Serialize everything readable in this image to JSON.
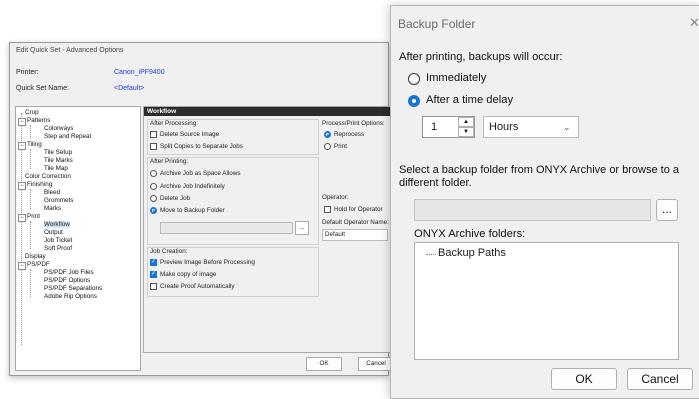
{
  "quickset": {
    "title": "Edit Quick Set - Advanced Options",
    "printer_label": "Printer:",
    "printer_value": "Canon_iPF9400",
    "quickset_label": "Quick Set Name:",
    "quickset_value": "<Default>",
    "tree": [
      "Crop",
      "Patterns",
      "Colorways",
      "Step and Repeat",
      "Tiling",
      "Tile Setup",
      "Tile Marks",
      "Tile Map",
      "Color Correction",
      "Finishing",
      "Bleed",
      "Grommets",
      "Marks",
      "Print",
      "Workflow",
      "Output",
      "Job Ticket",
      "Soft Proof",
      "Display",
      "PS/PDF",
      "PS/PDF Job Files",
      "PS/PDF Options",
      "PS/PDF Separations",
      "Adobe Rip Options"
    ],
    "workflow": {
      "header": "Workflow",
      "after_processing": "After Processing:",
      "delete_source": "Delete Source Image",
      "split_copies": "Split Copies to Separate Jobs",
      "process_print_options": "Process/Print Options:",
      "reprocess": "Reprocess",
      "print": "Print",
      "after_printing": "After Printing:",
      "archive_space": "Archive Job as Space Allows",
      "archive_indef": "Archive Job Indefinitely",
      "delete_job": "Delete Job",
      "move_backup": "Move to Backup Folder",
      "browse": "...",
      "operator": "Operator:",
      "hold_operator": "Hold for Operator",
      "default_operator_name": "Default Operator Name:",
      "default_value": "Default",
      "job_creation": "Job Creation:",
      "preview": "Preview Image Before Processing",
      "make_copy": "Make copy of image",
      "create_proof": "Create Proof Automatically"
    },
    "ok": "OK",
    "cancel": "Cancel"
  },
  "backup": {
    "title": "Backup Folder",
    "close": "✕",
    "after_printing": "After printing, backups will occur:",
    "immediately": "Immediately",
    "after_delay": "After a time delay",
    "delay_value": "1",
    "unit": "Hours",
    "select_text_1": "Select a backup folder from ONYX Archive or browse to a",
    "select_text_2": "different folder.",
    "browse": "...",
    "archive_label": "ONYX Archive folders:",
    "archive_item": "Backup Paths",
    "ok": "OK",
    "cancel": "Cancel"
  },
  "colors": {
    "accent": "#1a73d9",
    "link": "#1f3fd0",
    "header": "#2c2c2c"
  }
}
